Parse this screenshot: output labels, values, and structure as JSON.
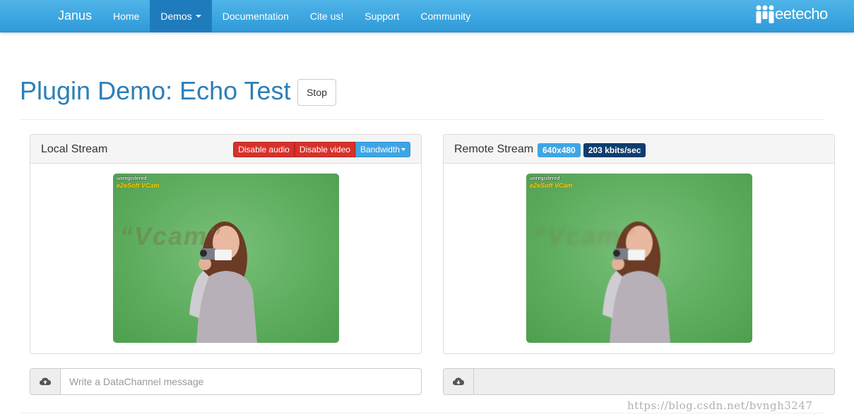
{
  "navbar": {
    "brand": "Janus",
    "items": [
      {
        "label": "Home"
      },
      {
        "label": "Demos"
      },
      {
        "label": "Documentation"
      },
      {
        "label": "Cite us!"
      },
      {
        "label": "Support"
      },
      {
        "label": "Community"
      }
    ],
    "active_item": "Demos",
    "logo_text": "eetecho"
  },
  "page": {
    "title": "Plugin Demo: Echo Test",
    "stop_label": "Stop"
  },
  "local_panel": {
    "title": "Local Stream",
    "buttons": {
      "disable_audio": "Disable audio",
      "disable_video": "Disable video",
      "bandwidth": "Bandwidth"
    },
    "video": {
      "overlay_small": "unregistered",
      "overlay_brand": "e2eSoft VCam",
      "watermark": "“Vcam”"
    }
  },
  "remote_panel": {
    "title": "Remote Stream",
    "resolution_badge": "640x480",
    "bitrate_badge": "203 kbits/sec",
    "video": {
      "overlay_small": "unregistered",
      "overlay_brand": "e2eSoft VCam",
      "watermark": "“Vcam”"
    }
  },
  "datachannel": {
    "send_placeholder": "Write a DataChannel message",
    "receive_value": ""
  },
  "footer": {
    "url_watermark": "https://blog.csdn.net/bvngh3247"
  },
  "colors": {
    "navbar": "#2f9ad8",
    "title": "#2c7fb8",
    "danger": "#d9302b",
    "info": "#3ea6e4",
    "primary_dark": "#0e3d6e"
  }
}
